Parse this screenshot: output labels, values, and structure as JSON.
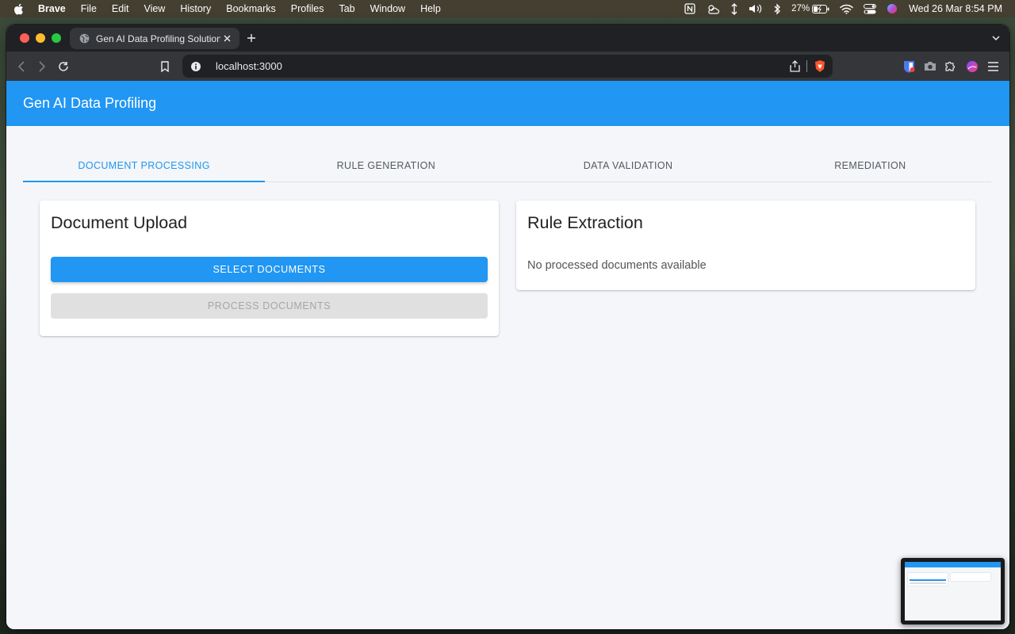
{
  "menubar": {
    "app_name": "Brave",
    "items": [
      "File",
      "Edit",
      "View",
      "History",
      "Bookmarks",
      "Profiles",
      "Tab",
      "Window",
      "Help"
    ],
    "battery": "27%",
    "clock": "Wed 26 Mar  8:54 PM"
  },
  "browser": {
    "tab_title": "Gen AI Data Profiling Solution",
    "url": "localhost:3000"
  },
  "app": {
    "title": "Gen AI Data Profiling",
    "tabs": [
      "DOCUMENT PROCESSING",
      "RULE GENERATION",
      "DATA VALIDATION",
      "REMEDIATION"
    ],
    "active_tab": "DOCUMENT PROCESSING",
    "upload_card": {
      "title": "Document Upload",
      "select_button": "SELECT DOCUMENTS",
      "process_button": "PROCESS DOCUMENTS"
    },
    "extraction_card": {
      "title": "Rule Extraction",
      "empty_message": "No processed documents available"
    }
  },
  "colors": {
    "primary": "#2196f3",
    "disabled_bg": "#e0e0e0",
    "page_bg": "#f4f6f9"
  }
}
